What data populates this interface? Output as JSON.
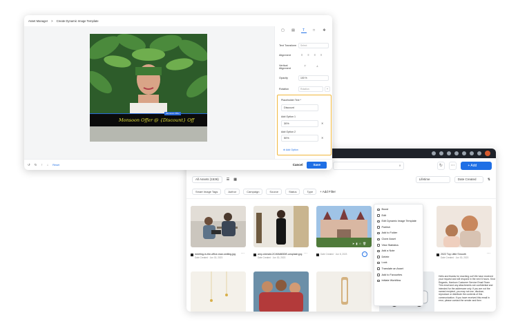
{
  "colors": {
    "accent": "#1f6fe5",
    "highlight": "#f0b63a",
    "banner_text": "#e8e33a"
  },
  "editor": {
    "breadcrumb": {
      "root": "Asset Manager",
      "separator": ">",
      "current": "Create Dynamic Image Template"
    },
    "banner_text": "Monsoon Offer @ {Discount} Off",
    "banner_tag": "Monsoon Offer",
    "side_tabs": [
      "frame-icon",
      "image-icon",
      "text-icon",
      "shape-icon",
      "move-icon"
    ],
    "props": {
      "text_transform_label": "Text Transform",
      "text_transform_value": "Select",
      "alignment_label": "Alignment",
      "vertical_alignment_label": "Vertical Alignment",
      "opacity_label": "Opacity",
      "opacity_value": "100 %",
      "rotation_label": "Rotation",
      "rotation_value": "Rotation"
    },
    "placeholder": {
      "label": "Placeholder Text *",
      "value": "Discount",
      "option1_label": "Add Option 1",
      "option1_value": "30%",
      "option2_label": "Add Option 2",
      "option2_value": "50%",
      "add_option": "Add Option"
    },
    "footer": {
      "reset": "Reset",
      "cancel": "Cancel",
      "save": "Save"
    }
  },
  "library": {
    "search_value": "",
    "add_asset": "+ Add Asset",
    "filter_all_assets": "All Assets (1536)",
    "sort_lifetime": "Lifetime",
    "sort_date": "Date Created",
    "filters": [
      "Smart Image Tags",
      "Author",
      "Campaign",
      "Source",
      "Status",
      "Type"
    ],
    "add_filter": "+ Add Filter",
    "cards": [
      {
        "title": "meeting-in-the-office-man-smiling.jpg",
        "date": "Date Created · Jun 30, 2023"
      },
      {
        "title": "amy-sherald-2C49A883DE-unsplash.jpg",
        "date": "Date Created · Jun 30, 2023"
      },
      {
        "title": "",
        "date": "Date Created · Jun 8, 2023"
      },
      {
        "title": "",
        "date": ""
      },
      {
        "title": "2022 Top Little Smooth",
        "date": "Date Created · Jun 30, 2023"
      }
    ],
    "context_menu": [
      "Boost",
      "Edit",
      "Edit Dynamic Image Template",
      "Publish",
      "Add to Folder",
      "Clone Asset",
      "View Statistics",
      "Add a Note",
      "Delete",
      "Lock",
      "Translate an Asset",
      "Add to Favourites",
      "Initiate Workflow"
    ],
    "email_text": "Hello and thanks for reaching out! We have received your request and will respond in the next 6 hours. Kind Regards, Harrison Customer Service Email Team. This email and any attachments are confidential and intended for the addressee only. If you are not the named recipient, you may not use, disclose, reproduce or distribute the contents of this communication. If you have received this email in error, please contact the sender and then"
  }
}
